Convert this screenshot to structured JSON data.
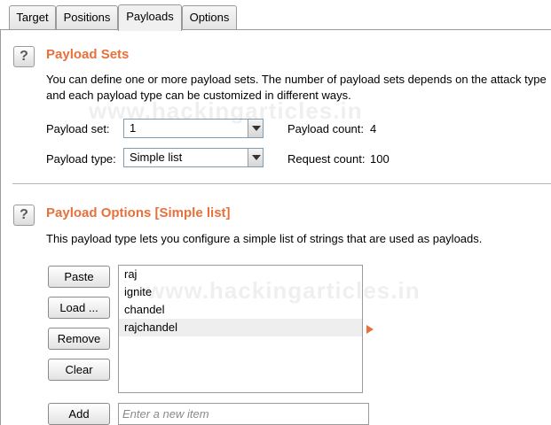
{
  "tabs": [
    {
      "label": "Target"
    },
    {
      "label": "Positions"
    },
    {
      "label": "Payloads"
    },
    {
      "label": "Options"
    }
  ],
  "active_tab": "Payloads",
  "payload_sets": {
    "help": "?",
    "title": "Payload Sets",
    "description_line1": "You can define one or more payload sets. The number of payload sets depends on the attack type",
    "description_line2": "and each payload type can be customized in different ways.",
    "set_label": "Payload set:",
    "set_value": "1",
    "type_label": "Payload type:",
    "type_value": "Simple list",
    "count_label": "Payload count:",
    "count_value": "4",
    "request_label": "Request count:",
    "request_value": "100"
  },
  "payload_options": {
    "help": "?",
    "title": "Payload Options [Simple list]",
    "description": "This payload type lets you configure a simple list of strings that are used as payloads.",
    "buttons": {
      "paste": "Paste",
      "load": "Load ...",
      "remove": "Remove",
      "clear": "Clear",
      "add": "Add"
    },
    "items": [
      "raj",
      "ignite",
      "chandel",
      "rajchandel"
    ],
    "selected_index": 3,
    "add_placeholder": "Enter a new item"
  },
  "watermark": "www.hackingarticles.in",
  "colors": {
    "accent": "#e8703a",
    "border": "#9a9a9a"
  }
}
